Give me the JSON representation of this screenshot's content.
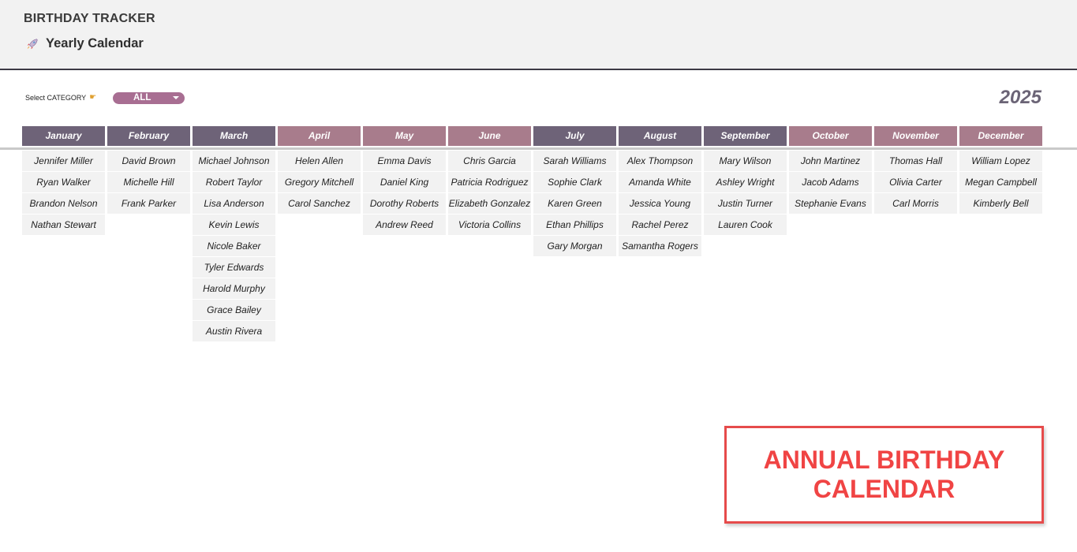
{
  "header": {
    "app_title": "BIRTHDAY TRACKER",
    "page_icon": "rocket-icon",
    "page_title": "Yearly Calendar"
  },
  "category": {
    "label": "Select CATEGORY",
    "pointer_icon": "pointing-hand-icon",
    "selected": "ALL"
  },
  "year": "2025",
  "months": [
    {
      "name": "January",
      "style": "dark",
      "people": [
        "Jennifer Miller",
        "Ryan Walker",
        "Brandon Nelson",
        "Nathan Stewart"
      ]
    },
    {
      "name": "February",
      "style": "dark",
      "people": [
        "David Brown",
        "Michelle Hill",
        "Frank Parker"
      ]
    },
    {
      "name": "March",
      "style": "dark",
      "people": [
        "Michael Johnson",
        "Robert Taylor",
        "Lisa Anderson",
        "Kevin Lewis",
        "Nicole Baker",
        "Tyler Edwards",
        "Harold Murphy",
        "Grace Bailey",
        "Austin Rivera"
      ]
    },
    {
      "name": "April",
      "style": "rose",
      "people": [
        "Helen Allen",
        "Gregory Mitchell",
        "Carol Sanchez"
      ]
    },
    {
      "name": "May",
      "style": "rose",
      "people": [
        "Emma Davis",
        "Daniel King",
        "Dorothy Roberts",
        "Andrew Reed"
      ]
    },
    {
      "name": "June",
      "style": "rose",
      "people": [
        "Chris Garcia",
        "Patricia Rodriguez",
        "Elizabeth Gonzalez",
        "Victoria Collins"
      ]
    },
    {
      "name": "July",
      "style": "dark",
      "people": [
        "Sarah Williams",
        "Sophie Clark",
        "Karen Green",
        "Ethan Phillips",
        "Gary Morgan"
      ]
    },
    {
      "name": "August",
      "style": "dark",
      "people": [
        "Alex Thompson",
        "Amanda White",
        "Jessica Young",
        "Rachel Perez",
        "Samantha Rogers"
      ]
    },
    {
      "name": "September",
      "style": "dark",
      "people": [
        "Mary Wilson",
        "Ashley Wright",
        "Justin Turner",
        "Lauren Cook"
      ]
    },
    {
      "name": "October",
      "style": "rose",
      "people": [
        "John Martinez",
        "Jacob Adams",
        "Stephanie Evans"
      ]
    },
    {
      "name": "November",
      "style": "rose",
      "people": [
        "Thomas Hall",
        "Olivia Carter",
        "Carl Morris"
      ]
    },
    {
      "name": "December",
      "style": "rose",
      "people": [
        "William Lopez",
        "Megan Campbell",
        "Kimberly Bell"
      ]
    }
  ],
  "annotation": {
    "text": "ANNUAL BIRTHDAY CALENDAR"
  },
  "colors": {
    "header_dark": "#6e6378",
    "header_rose": "#a87c8c",
    "dropdown": "#a86e92",
    "annotation_border": "#e64b4b",
    "annotation_text": "#f04444",
    "year": "#6b6476"
  }
}
